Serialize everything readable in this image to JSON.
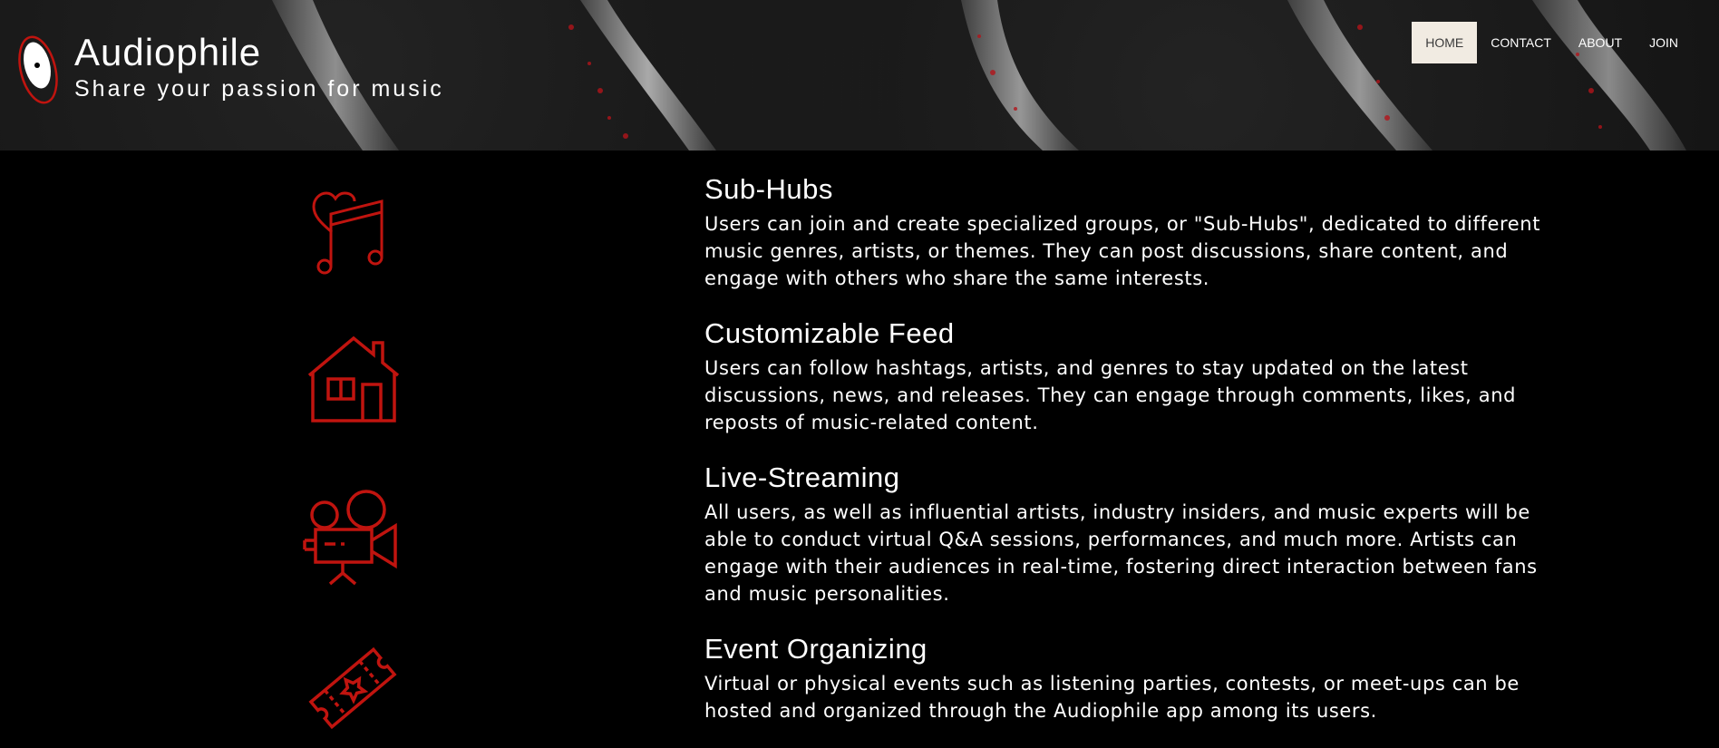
{
  "brand": {
    "title": "Audiophile",
    "tagline": "Share your passion for music",
    "logo_icon": "vinyl-record-icon"
  },
  "nav": {
    "items": [
      {
        "label": "HOME",
        "active": true
      },
      {
        "label": "CONTACT",
        "active": false
      },
      {
        "label": "ABOUT",
        "active": false
      },
      {
        "label": "JOIN",
        "active": false
      }
    ]
  },
  "features": [
    {
      "icon": "heart-music-note-icon",
      "title": "Sub-Hubs",
      "text": "Users can join and create specialized groups, or \"Sub-Hubs\", dedicated to different music genres, artists, or themes. They can post discussions, share content, and engage with others who share the same interests."
    },
    {
      "icon": "house-icon",
      "title": "Customizable Feed",
      "text": "Users can follow hashtags, artists, and genres to stay updated on the latest discussions, news, and releases. They can engage through comments, likes, and reposts of music-related content."
    },
    {
      "icon": "video-camera-icon",
      "title": "Live-Streaming",
      "text": "All users, as well as influential artists, industry insiders, and music experts will be able to conduct virtual Q&A sessions, performances, and much more. Artists can engage with their audiences in real-time, fostering direct interaction between fans and music personalities."
    },
    {
      "icon": "ticket-icon",
      "title": "Event Organizing",
      "text": "Virtual or physical events such as listening parties, contests, or meet-ups can be hosted and organized through the Audiophile app among its users."
    }
  ],
  "colors": {
    "accent_red": "#c0140f",
    "active_nav_bg": "#f1ebe2",
    "background": "#000000"
  }
}
